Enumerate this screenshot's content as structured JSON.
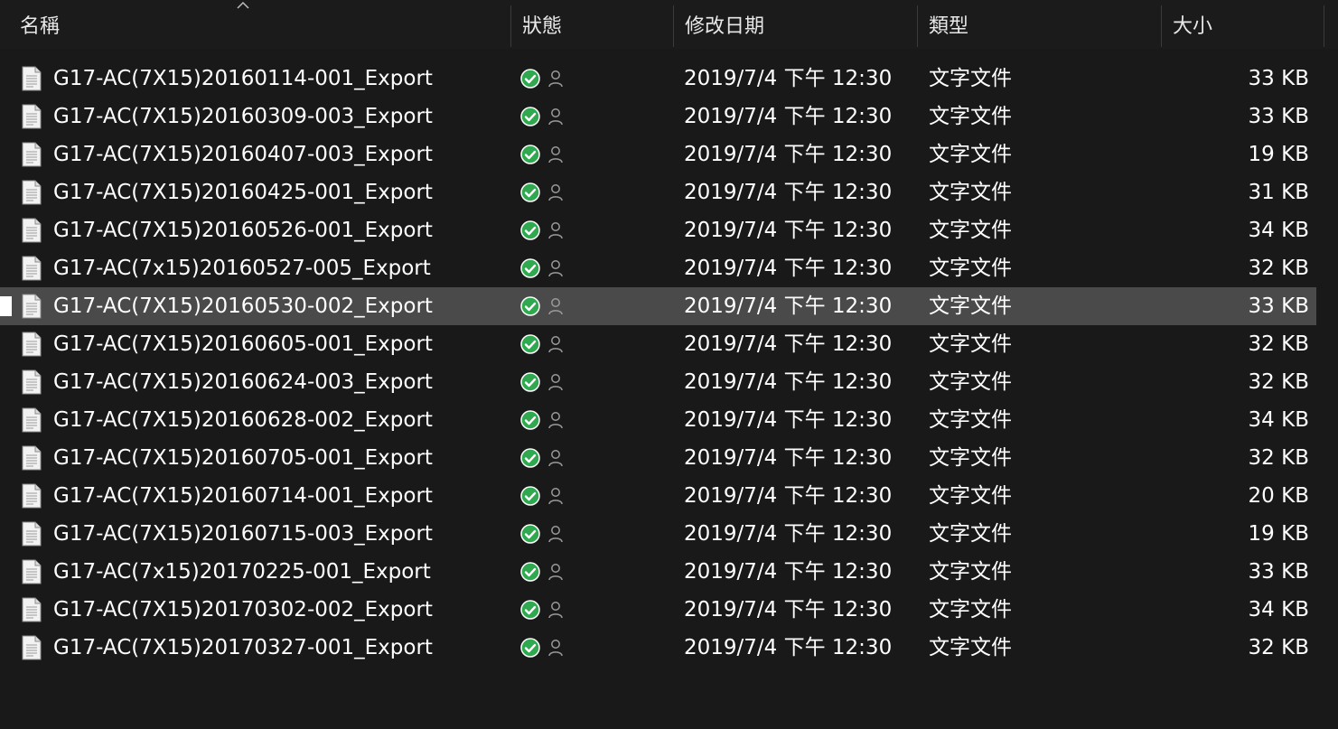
{
  "columns": {
    "name": "名稱",
    "status": "狀態",
    "modified": "修改日期",
    "type": "類型",
    "size": "大小"
  },
  "sort": {
    "column": "name",
    "direction": "ascending",
    "icon": "chevron-up-icon"
  },
  "colors": {
    "background": "#191919",
    "selected_row": "#4a4a4a",
    "status_ok": "#2fa84f"
  },
  "files": [
    {
      "name": "G17-AC(7X15)20160114-001_Export",
      "status": "synced-available-offline",
      "modified": "2019/7/4 下午 12:30",
      "type": "文字文件",
      "size": "33 KB",
      "selected": false
    },
    {
      "name": "G17-AC(7X15)20160309-003_Export",
      "status": "synced-available-offline",
      "modified": "2019/7/4 下午 12:30",
      "type": "文字文件",
      "size": "33 KB",
      "selected": false
    },
    {
      "name": "G17-AC(7X15)20160407-003_Export",
      "status": "synced-available-offline",
      "modified": "2019/7/4 下午 12:30",
      "type": "文字文件",
      "size": "19 KB",
      "selected": false
    },
    {
      "name": "G17-AC(7X15)20160425-001_Export",
      "status": "synced-available-offline",
      "modified": "2019/7/4 下午 12:30",
      "type": "文字文件",
      "size": "31 KB",
      "selected": false
    },
    {
      "name": "G17-AC(7X15)20160526-001_Export",
      "status": "synced-available-offline",
      "modified": "2019/7/4 下午 12:30",
      "type": "文字文件",
      "size": "34 KB",
      "selected": false
    },
    {
      "name": "G17-AC(7x15)20160527-005_Export",
      "status": "synced-available-offline",
      "modified": "2019/7/4 下午 12:30",
      "type": "文字文件",
      "size": "32 KB",
      "selected": false
    },
    {
      "name": "G17-AC(7X15)20160530-002_Export",
      "status": "synced-available-offline",
      "modified": "2019/7/4 下午 12:30",
      "type": "文字文件",
      "size": "33 KB",
      "selected": true
    },
    {
      "name": "G17-AC(7X15)20160605-001_Export",
      "status": "synced-available-offline",
      "modified": "2019/7/4 下午 12:30",
      "type": "文字文件",
      "size": "32 KB",
      "selected": false
    },
    {
      "name": "G17-AC(7X15)20160624-003_Export",
      "status": "synced-available-offline",
      "modified": "2019/7/4 下午 12:30",
      "type": "文字文件",
      "size": "32 KB",
      "selected": false
    },
    {
      "name": "G17-AC(7X15)20160628-002_Export",
      "status": "synced-available-offline",
      "modified": "2019/7/4 下午 12:30",
      "type": "文字文件",
      "size": "34 KB",
      "selected": false
    },
    {
      "name": "G17-AC(7X15)20160705-001_Export",
      "status": "synced-available-offline",
      "modified": "2019/7/4 下午 12:30",
      "type": "文字文件",
      "size": "32 KB",
      "selected": false
    },
    {
      "name": "G17-AC(7X15)20160714-001_Export",
      "status": "synced-available-offline",
      "modified": "2019/7/4 下午 12:30",
      "type": "文字文件",
      "size": "20 KB",
      "selected": false
    },
    {
      "name": "G17-AC(7X15)20160715-003_Export",
      "status": "synced-available-offline",
      "modified": "2019/7/4 下午 12:30",
      "type": "文字文件",
      "size": "19 KB",
      "selected": false
    },
    {
      "name": "G17-AC(7x15)20170225-001_Export",
      "status": "synced-available-offline",
      "modified": "2019/7/4 下午 12:30",
      "type": "文字文件",
      "size": "33 KB",
      "selected": false
    },
    {
      "name": "G17-AC(7X15)20170302-002_Export",
      "status": "synced-available-offline",
      "modified": "2019/7/4 下午 12:30",
      "type": "文字文件",
      "size": "34 KB",
      "selected": false
    },
    {
      "name": "G17-AC(7X15)20170327-001_Export",
      "status": "synced-available-offline",
      "modified": "2019/7/4 下午 12:30",
      "type": "文字文件",
      "size": "32 KB",
      "selected": false
    }
  ]
}
